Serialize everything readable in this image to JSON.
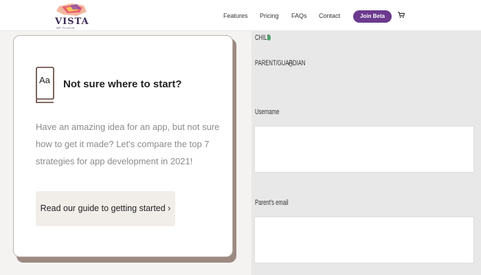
{
  "header": {
    "logo_text": "VISTA",
    "logo_subtext": "WP PLUGIN",
    "nav": {
      "features": "Features",
      "pricing": "Pricing",
      "faqs": "FAQs",
      "contact": "Contact"
    },
    "join_button": "Join Beta",
    "cart_icon": "cart-icon"
  },
  "card": {
    "icon": "book-aa-icon",
    "icon_text": "Aa",
    "title": "Not sure where to start?",
    "body": "Have an amazing idea for an app, but not sure how to get it made? Let's compare the top 7 strategies for app development in 2021!",
    "button": "Read our guide to getting started ›"
  },
  "form": {
    "child_label": "CHILD",
    "parent_label": "PARENT/GUARDIAN",
    "username_label": "Username",
    "username_value": "",
    "email_label": "Parent's email",
    "email_value": "",
    "selected_role": "CHILD"
  },
  "colors": {
    "accent": "#6b3a8e",
    "radio_selected": "#4ba66b",
    "form_bg": "#e8e8e8"
  }
}
